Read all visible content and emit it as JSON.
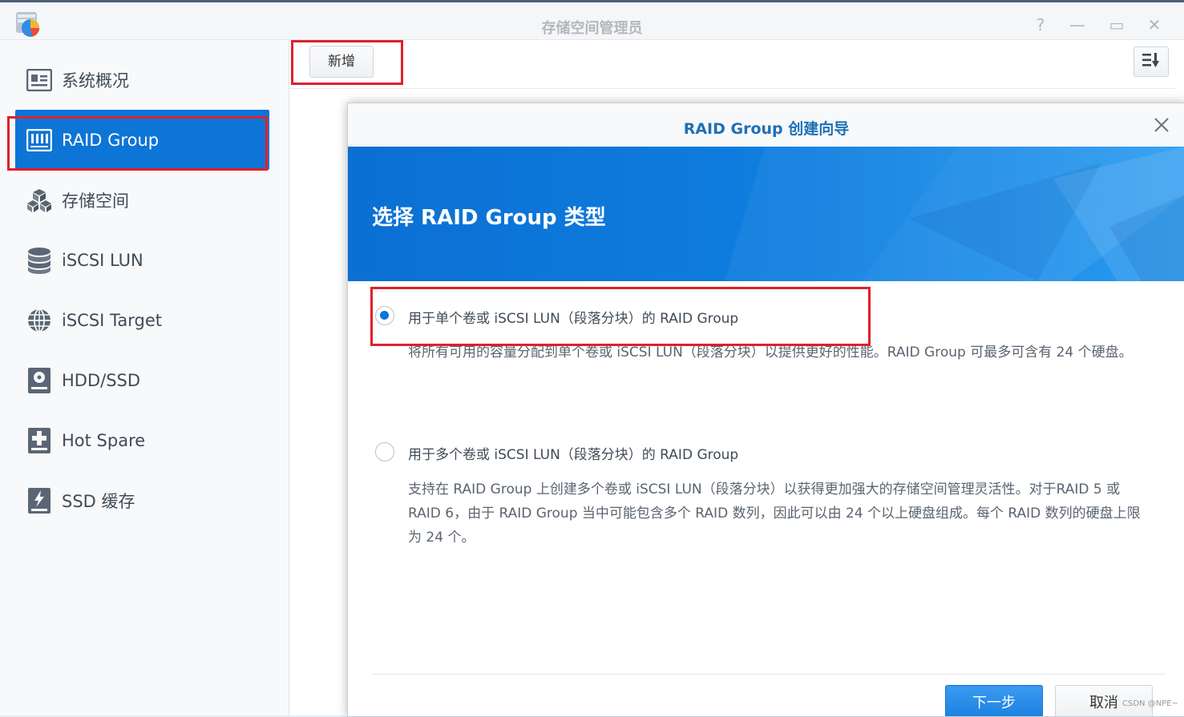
{
  "window": {
    "title": "存储空间管理员",
    "help_glyph": "?",
    "minimize_glyph": "—",
    "maximize_glyph": "▭",
    "close_glyph": "✕"
  },
  "sidebar": {
    "items": [
      {
        "label": "系统概况",
        "icon": "overview-icon",
        "active": false
      },
      {
        "label": "RAID Group",
        "icon": "raid-group-icon",
        "active": true
      },
      {
        "label": "存储空间",
        "icon": "storage-cubes-icon",
        "active": false
      },
      {
        "label": "iSCSI LUN",
        "icon": "database-icon",
        "active": false
      },
      {
        "label": "iSCSI Target",
        "icon": "globe-icon",
        "active": false
      },
      {
        "label": "HDD/SSD",
        "icon": "hdd-icon",
        "active": false
      },
      {
        "label": "Hot Spare",
        "icon": "hot-spare-icon",
        "active": false
      },
      {
        "label": "SSD 缓存",
        "icon": "ssd-cache-icon",
        "active": false
      }
    ]
  },
  "toolbar": {
    "add_label": "新增",
    "sort_icon": "sort-icon"
  },
  "dialog": {
    "title": "RAID Group 创建向导",
    "banner_title": "选择 RAID Group 类型",
    "options": [
      {
        "label": "用于单个卷或 iSCSI LUN（段落分块）的 RAID Group",
        "description": "将所有可用的容量分配到单个卷或 iSCSI LUN（段落分块）以提供更好的性能。RAID Group 可最多可含有 24 个硬盘。",
        "selected": true
      },
      {
        "label": "用于多个卷或 iSCSI LUN（段落分块）的 RAID Group",
        "description": "支持在 RAID Group 上创建多个卷或 iSCSI LUN（段落分块）以获得更加强大的存储空间管理灵活性。对于RAID 5 或 RAID 6，由于 RAID Group 当中可能包含多个 RAID 数列，因此可以由 24 个以上硬盘组成。每个 RAID 数列的硬盘上限为 24 个。",
        "selected": false
      }
    ],
    "next_label": "下一步",
    "cancel_label": "取消"
  },
  "watermark": "CSDN @NPE~",
  "colors": {
    "accent": "#0c75d6",
    "highlight_box": "#e0202a",
    "dialog_title": "#1f6fb5"
  }
}
